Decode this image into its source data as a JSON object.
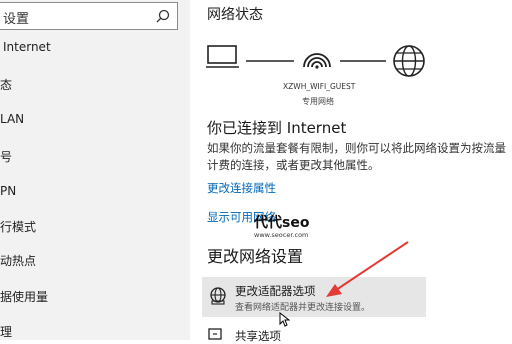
{
  "sidebar": {
    "search_text": "设置",
    "items": [
      {
        "label": "Internet",
        "active": true
      },
      {
        "label": "态"
      },
      {
        "label": "LAN"
      },
      {
        "label": "号"
      },
      {
        "label": "PN"
      },
      {
        "label": "行模式"
      },
      {
        "label": "动热点"
      },
      {
        "label": "据使用量"
      },
      {
        "label": "理"
      }
    ]
  },
  "status": {
    "title": "网络状态",
    "ssid": "XZWH_WIFI_GUEST",
    "network_type": "专用网络",
    "connected_title": "你已连接到 Internet",
    "description": "如果你的流量套餐有限制，则你可以将此网络设置为按流量计费的连接，或者更改其他属性。",
    "link_change_properties": "更改连接属性",
    "link_show_networks": "显示可用网络"
  },
  "watermark": {
    "main": "代代seo",
    "sub": "www.seocer.com"
  },
  "change_settings": {
    "title": "更改网络设置",
    "adapter_title": "更改适配器选项",
    "adapter_desc": "查看网络适配器并更改连接设置。",
    "sharing_title": "共享选项"
  },
  "colors": {
    "link": "#0067b8",
    "arrow": "#e53935",
    "sidebar_bg": "#f2f2f2",
    "option_hover_bg": "#e6e6e6"
  }
}
